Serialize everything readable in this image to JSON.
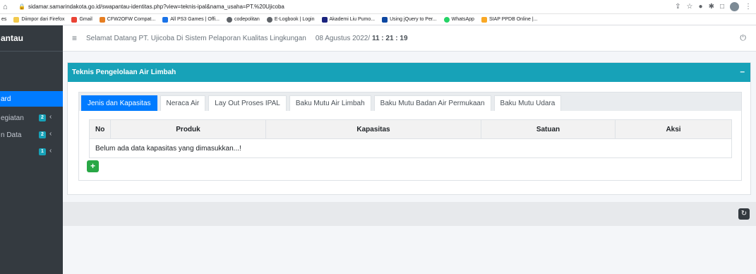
{
  "browser": {
    "url": "sidamar.samarindakota.go.id/swapantau-identitas.php?view=teknis-ipal&nama_usaha=PT.%20Ujicoba",
    "bookmarks": [
      {
        "label": "es",
        "color": "#ffffff"
      },
      {
        "label": "Diimpor dari Firefox",
        "color": "#f2c94c"
      },
      {
        "label": "Gmail",
        "color": "#ea4335"
      },
      {
        "label": "CFW2OFW Compat...",
        "color": "#e67e22"
      },
      {
        "label": "All PS3 Games | Offi...",
        "color": "#1a73e8"
      },
      {
        "label": "codepolitan",
        "color": "#5f6368"
      },
      {
        "label": "E-Logbook | Login",
        "color": "#5f6368"
      },
      {
        "label": "Akademi Liu Pumo...",
        "color": "#1a237e"
      },
      {
        "label": "Using jQuery to Per...",
        "color": "#0d47a1"
      },
      {
        "label": "WhatsApp",
        "color": "#25d366"
      },
      {
        "label": "SIAP PPDB Online |...",
        "color": "#f9a825"
      }
    ]
  },
  "sidebar": {
    "brand": "antau",
    "items": [
      {
        "label": "ard",
        "active": true
      },
      {
        "label": "egiatan",
        "badge": "2",
        "active": false
      },
      {
        "label": "n Data",
        "badge": "2",
        "active": false
      },
      {
        "label": "",
        "badge": "1",
        "active": false
      }
    ]
  },
  "topbar": {
    "welcome": "Selamat Datang PT. Ujicoba Di Sistem Pelaporan Kualitas Lingkungan",
    "date": "08 Agustus 2022/",
    "clock": "11 : 21 : 19"
  },
  "card": {
    "title": "Teknis Pengelolaan Air Limbah",
    "tabs": [
      "Jenis dan Kapasitas",
      "Neraca Air",
      "Lay Out Proses IPAL",
      "Baku Mutu Air Limbah",
      "Baku Mutu Badan Air Permukaan",
      "Baku Mutu Udara"
    ],
    "table": {
      "headers": [
        "No",
        "Produk",
        "Kapasitas",
        "Satuan",
        "Aksi"
      ],
      "empty_message": "Belum ada data kapasitas yang dimasukkan...!"
    }
  },
  "colors": {
    "teal": "#17a2b8",
    "primary": "#007bff",
    "sidebar": "#343a40",
    "success": "#28a745"
  }
}
